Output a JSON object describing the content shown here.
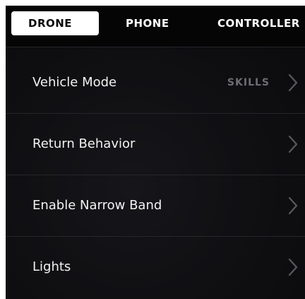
{
  "tabs": [
    {
      "label": "DRONE",
      "active": true
    },
    {
      "label": "PHONE",
      "active": false
    },
    {
      "label": "CONTROLLER",
      "active": false
    }
  ],
  "settings": {
    "items": [
      {
        "label": "Vehicle Mode",
        "value": "SKILLS",
        "icon": "chevron-right-icon"
      },
      {
        "label": "Return Behavior",
        "value": "",
        "icon": "chevron-right-icon"
      },
      {
        "label": "Enable Narrow Band",
        "value": "",
        "icon": "chevron-right-icon"
      },
      {
        "label": "Lights",
        "value": "",
        "icon": "chevron-right-icon"
      }
    ]
  },
  "colors": {
    "background": "#0e0e11",
    "tab_active_bg": "#ffffff",
    "tab_active_text": "#0a0a0a",
    "text": "#f2f2f2",
    "value_text": "#6e6e72",
    "chevron": "#5a5a5e"
  }
}
